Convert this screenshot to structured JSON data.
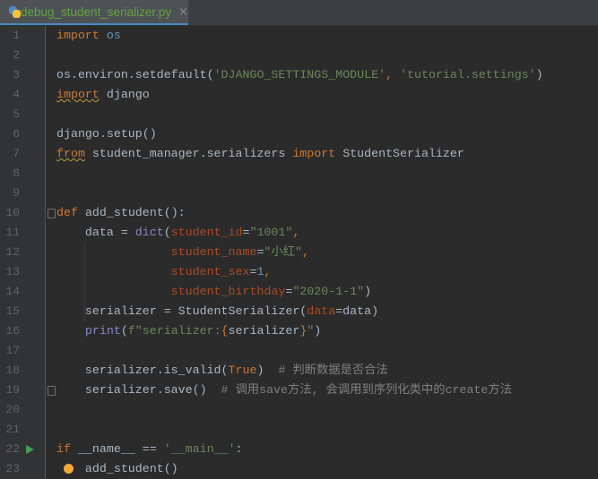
{
  "tab": {
    "filename": "debug_student_serializer.py",
    "close": "×"
  },
  "lines": [
    [
      [
        "import",
        "kw"
      ],
      [
        " "
      ],
      [
        "os",
        "mod"
      ]
    ],
    [],
    [
      [
        "os.environ.setdefault("
      ],
      [
        "'DJANGO_SETTINGS_MODULE'",
        "str"
      ],
      [
        ", ",
        "kw"
      ],
      [
        "'tutorial.settings'",
        "str"
      ],
      [
        ")"
      ]
    ],
    [
      [
        "import",
        "kw wavy"
      ],
      [
        " django"
      ]
    ],
    [],
    [
      [
        "django.setup()"
      ]
    ],
    [
      [
        "from",
        "kw wavy"
      ],
      [
        " student_manager.serializers "
      ],
      [
        "import",
        "kw"
      ],
      [
        " StudentSerializer"
      ]
    ],
    [],
    [],
    [
      [
        "def",
        "kw"
      ],
      [
        " "
      ],
      [
        "add_student",
        "fn"
      ],
      [
        "():"
      ]
    ],
    [
      [
        "    data = "
      ],
      [
        "dict",
        "bi"
      ],
      [
        "("
      ],
      [
        "student_id",
        "par"
      ],
      [
        "="
      ],
      [
        "\"1001\"",
        "str"
      ],
      [
        ",",
        "kw"
      ]
    ],
    [
      [
        "                "
      ],
      [
        "student_name",
        "par"
      ],
      [
        "="
      ],
      [
        "\"小红\"",
        "str"
      ],
      [
        ",",
        "kw"
      ]
    ],
    [
      [
        "                "
      ],
      [
        "student_sex",
        "par"
      ],
      [
        "="
      ],
      [
        "1",
        "num"
      ],
      [
        ",",
        "kw"
      ]
    ],
    [
      [
        "                "
      ],
      [
        "student_birthday",
        "par"
      ],
      [
        "="
      ],
      [
        "\"2020-1-1\"",
        "str"
      ],
      [
        ")"
      ]
    ],
    [
      [
        "    serializer = StudentSerializer("
      ],
      [
        "data",
        "par"
      ],
      [
        "=data)"
      ]
    ],
    [
      [
        "    "
      ],
      [
        "print",
        "bi"
      ],
      [
        "("
      ],
      [
        "f\"serializer:",
        "str"
      ],
      [
        "{",
        "br"
      ],
      [
        "serializer"
      ],
      [
        "}",
        "br"
      ],
      [
        "\"",
        "str"
      ],
      [
        ")"
      ]
    ],
    [],
    [
      [
        "    serializer.is_valid("
      ],
      [
        "True",
        "kw"
      ],
      [
        ")  "
      ],
      [
        "# 判断数据是否合法",
        "cm"
      ]
    ],
    [
      [
        "    serializer.save()  "
      ],
      [
        "# 调用save方法, 会调用到序列化类中的create方法",
        "cm"
      ]
    ],
    [],
    [],
    [
      [
        "if",
        "kw"
      ],
      [
        " __name__ == "
      ],
      [
        "'__main__'",
        "str"
      ],
      [
        ":"
      ]
    ],
    [
      [
        "    add_student()"
      ]
    ]
  ],
  "colors": {
    "keyword": "#cc7832",
    "string": "#6a8759",
    "comment": "#808080",
    "text": "#a9b7c6",
    "param": "#aa4926"
  }
}
